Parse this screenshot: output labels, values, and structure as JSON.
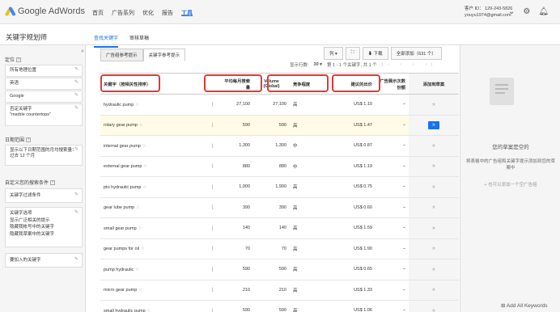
{
  "app": {
    "logo_text": "Google AdWords"
  },
  "topnav": {
    "items": [
      "首页",
      "广告系列",
      "优化",
      "报告",
      "工具"
    ],
    "active_index": 4
  },
  "account": {
    "id_line": "客户 ID： 129-243-5826",
    "email": "youyu1974@gmail.com",
    "dropdown_icon": "chevron-down-icon"
  },
  "icons": {
    "settings": "gear-icon",
    "notifications": "bell-icon"
  },
  "page": {
    "title": "关键字规划师"
  },
  "subtabs": [
    {
      "label": "查找关键字",
      "active": true
    },
    {
      "label": "审核草稿",
      "active": false
    }
  ],
  "sidebar": {
    "collapse_glyph": "«",
    "targeting_label": "定位",
    "targeting_boxes": [
      "所有地理位置",
      "英语",
      "Google"
    ],
    "negative_title": "否定关键字",
    "negative_value": "\"marble countertops\"",
    "date_label": "日期范围",
    "date_text": "显示以下日期范围的月均搜索量：过去 12 个月",
    "custom_label": "自定义您的搜索条件",
    "keyword_filter": "关键字过滤条件",
    "options_title": "关键字选项",
    "options_lines": [
      "显示广泛相关的提示",
      "隐藏我帐号中的关键字",
      "隐藏我草案中的关键字"
    ],
    "include_kw": "要加入的关键字"
  },
  "main": {
    "tabs": [
      {
        "label": "广告组参考提示",
        "active": false
      },
      {
        "label": "关键字参考提示",
        "active": true
      }
    ],
    "toolbar": {
      "columns": "列 ▾",
      "chart_glyph": "⛶",
      "download": "⬇ 下载",
      "add_all": "全部添加（631 个）"
    },
    "pager": {
      "rows_label": "显示行数:",
      "rows_value": "30 ▾",
      "range": "第 1 - 1 个关键字, 共 1 个",
      "arrows": "|‹ ‹ › ›|"
    },
    "headers": {
      "keyword": "关键字（按相关性排序）",
      "avg": "平均每月搜索量",
      "volume": "Volume (Global)",
      "competition": "竞争程度",
      "bid": "建议的出价",
      "impr_share": "广告展示次数份额",
      "add": "添加到草案"
    },
    "rows": [
      {
        "keyword": "hydraulic pump",
        "avg": "27,100",
        "volume": "27,100",
        "comp": "高",
        "bid": "US$ 1.10",
        "share": "–"
      },
      {
        "keyword": "rotary gear pump",
        "avg": "590",
        "volume": "590",
        "comp": "高",
        "bid": "US$ 1.47",
        "share": "–"
      },
      {
        "keyword": "internal gear pump",
        "avg": "1,300",
        "volume": "1,300",
        "comp": "中",
        "bid": "US$ 0.87",
        "share": "–"
      },
      {
        "keyword": "external gear pump",
        "avg": "880",
        "volume": "880",
        "comp": "中",
        "bid": "US$ 1.19",
        "share": "–"
      },
      {
        "keyword": "pto hydraulic pump",
        "avg": "1,900",
        "volume": "1,900",
        "comp": "高",
        "bid": "US$ 0.75",
        "share": "–"
      },
      {
        "keyword": "gear lube pump",
        "avg": "390",
        "volume": "390",
        "comp": "高",
        "bid": "US$ 0.60",
        "share": "–"
      },
      {
        "keyword": "small gear pump",
        "avg": "140",
        "volume": "140",
        "comp": "高",
        "bid": "US$ 1.59",
        "share": "–"
      },
      {
        "keyword": "gear pumps for oil",
        "avg": "70",
        "volume": "70",
        "comp": "高",
        "bid": "US$ 1.90",
        "share": "–"
      },
      {
        "keyword": "pump hydraulic",
        "avg": "590",
        "volume": "590",
        "comp": "高",
        "bid": "US$ 0.65",
        "share": "–"
      },
      {
        "keyword": "micro gear pump",
        "avg": "210",
        "volume": "210",
        "comp": "高",
        "bid": "US$ 1.33",
        "share": "–"
      },
      {
        "keyword": "small hydraulic pump",
        "avg": "590",
        "volume": "590",
        "comp": "高",
        "bid": "US$ 1.06",
        "share": "–"
      }
    ],
    "highlighted_row": 1
  },
  "right": {
    "empty_title": "您的草案是空的",
    "empty_desc": "将表格中的广告组和关键字提示添加到您的草案中",
    "add_link": "+ 也可以添加一个空广告组",
    "add_all": "Add All Keywords"
  }
}
